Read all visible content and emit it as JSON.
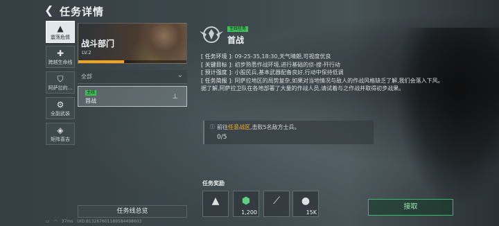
{
  "header": {
    "title": "任务详情"
  },
  "nav": [
    {
      "label": "震荡危情",
      "icon": "spearhead-icon",
      "active": true
    },
    {
      "label": "跨越生命线",
      "icon": "plus-icon",
      "active": false
    },
    {
      "label": "阿萨拉的...",
      "icon": "shield-icon",
      "active": false
    },
    {
      "label": "全副武装",
      "icon": "gear-icon",
      "active": false
    },
    {
      "label": "矩阵喜吉",
      "icon": "module-icon",
      "active": false
    }
  ],
  "mission_card": {
    "title": "战斗部门",
    "level": "LV.2",
    "progress": 0.42,
    "accent": "#f2a51c"
  },
  "filter": {
    "label": "全部"
  },
  "task_list": [
    {
      "tag": "主线",
      "name": "首战"
    }
  ],
  "overview_button": "任务线总览",
  "status_bar": {
    "ping": "37ms",
    "uid": "UID:813267601189584498603"
  },
  "detail": {
    "tag": "主线任务",
    "title": "首战",
    "info": [
      {
        "key": "[ 任务环境 ]",
        "value": ": 09-25-35,18:30,天气晴朗,可视度优良"
      },
      {
        "key": "[ 关键目标 ]",
        "value": ": 初步熟悉作战环境,进行基础的侦-搜-歼行动"
      },
      {
        "key": "[ 预计强度 ]",
        "value": ": 小股民兵,基本武器配备良好,行动中保持低调"
      },
      {
        "key": "[ 任务简报 ]",
        "value": ": 阿萨拉地区的局势复杂,如果对当地情况与敌人的作战风格缺乏了解,我们会落入下风。"
      }
    ],
    "briefing_extra": "据了解,阿萨拉卫队在各地部署了大量的作战人员,请试着与之作战并取得初步战果。"
  },
  "objective": {
    "prefix": "前往",
    "location": "任意战区",
    "suffix": ",击败5名敌方士兵。",
    "progress": "0/5"
  },
  "rewards": {
    "label": "任务奖励",
    "items": [
      {
        "icon": "spearhead-icon",
        "qty": ""
      },
      {
        "icon": "experience-icon",
        "qty": "1,200"
      },
      {
        "icon": "rifle-icon",
        "qty": ""
      },
      {
        "icon": "coin-icon",
        "qty": "15K"
      }
    ]
  },
  "accept_button": "接取",
  "colors": {
    "main_tag": "#3fbf5a",
    "highlight": "#f2b233",
    "accept": "#39b86a"
  }
}
